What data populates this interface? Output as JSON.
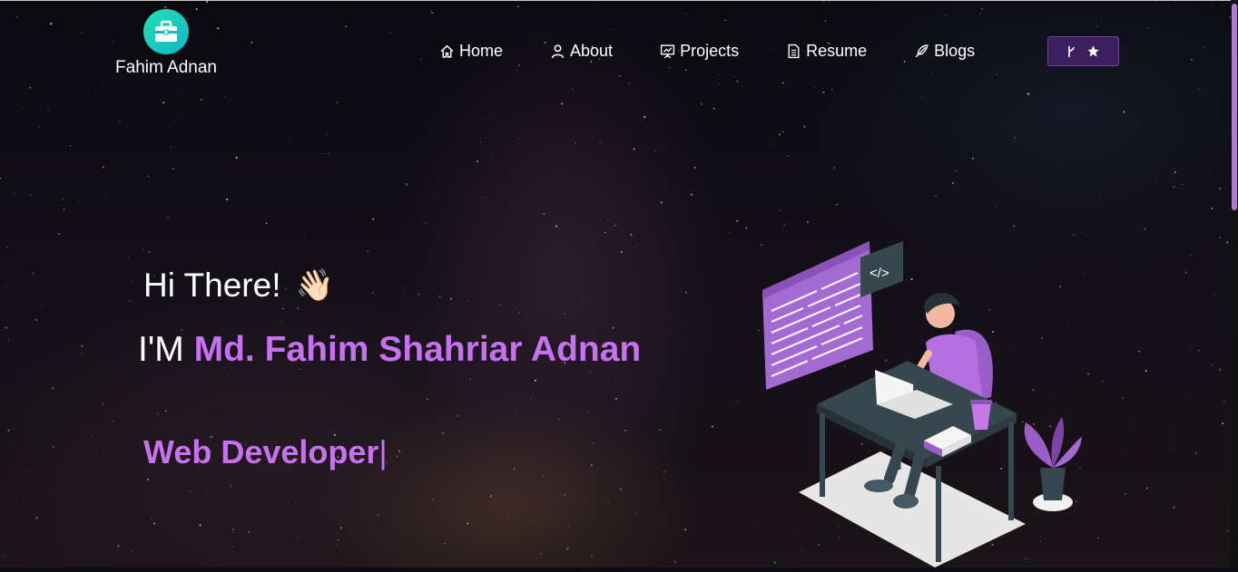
{
  "brand": {
    "name": "Fahim Adnan",
    "logo_icon": "briefcase-icon"
  },
  "nav": {
    "items": [
      {
        "label": "Home",
        "icon": "home-icon"
      },
      {
        "label": "About",
        "icon": "user-icon"
      },
      {
        "label": "Projects",
        "icon": "presentation-icon"
      },
      {
        "label": "Resume",
        "icon": "document-icon"
      },
      {
        "label": "Blogs",
        "icon": "feather-icon"
      }
    ],
    "fork_icon": "git-fork-icon",
    "star_icon": "star-icon"
  },
  "hero": {
    "greeting": "Hi There!",
    "wave_emoji": "👋🏻",
    "intro_prefix": "I'M",
    "intro_name": "Md. Fahim Shahriar Adnan",
    "role": "Web Developer",
    "cursor": "|"
  },
  "colors": {
    "accent": "#c770f0",
    "fork_button_bg": "#3b1f5e",
    "logo": "#1fc9b7"
  }
}
